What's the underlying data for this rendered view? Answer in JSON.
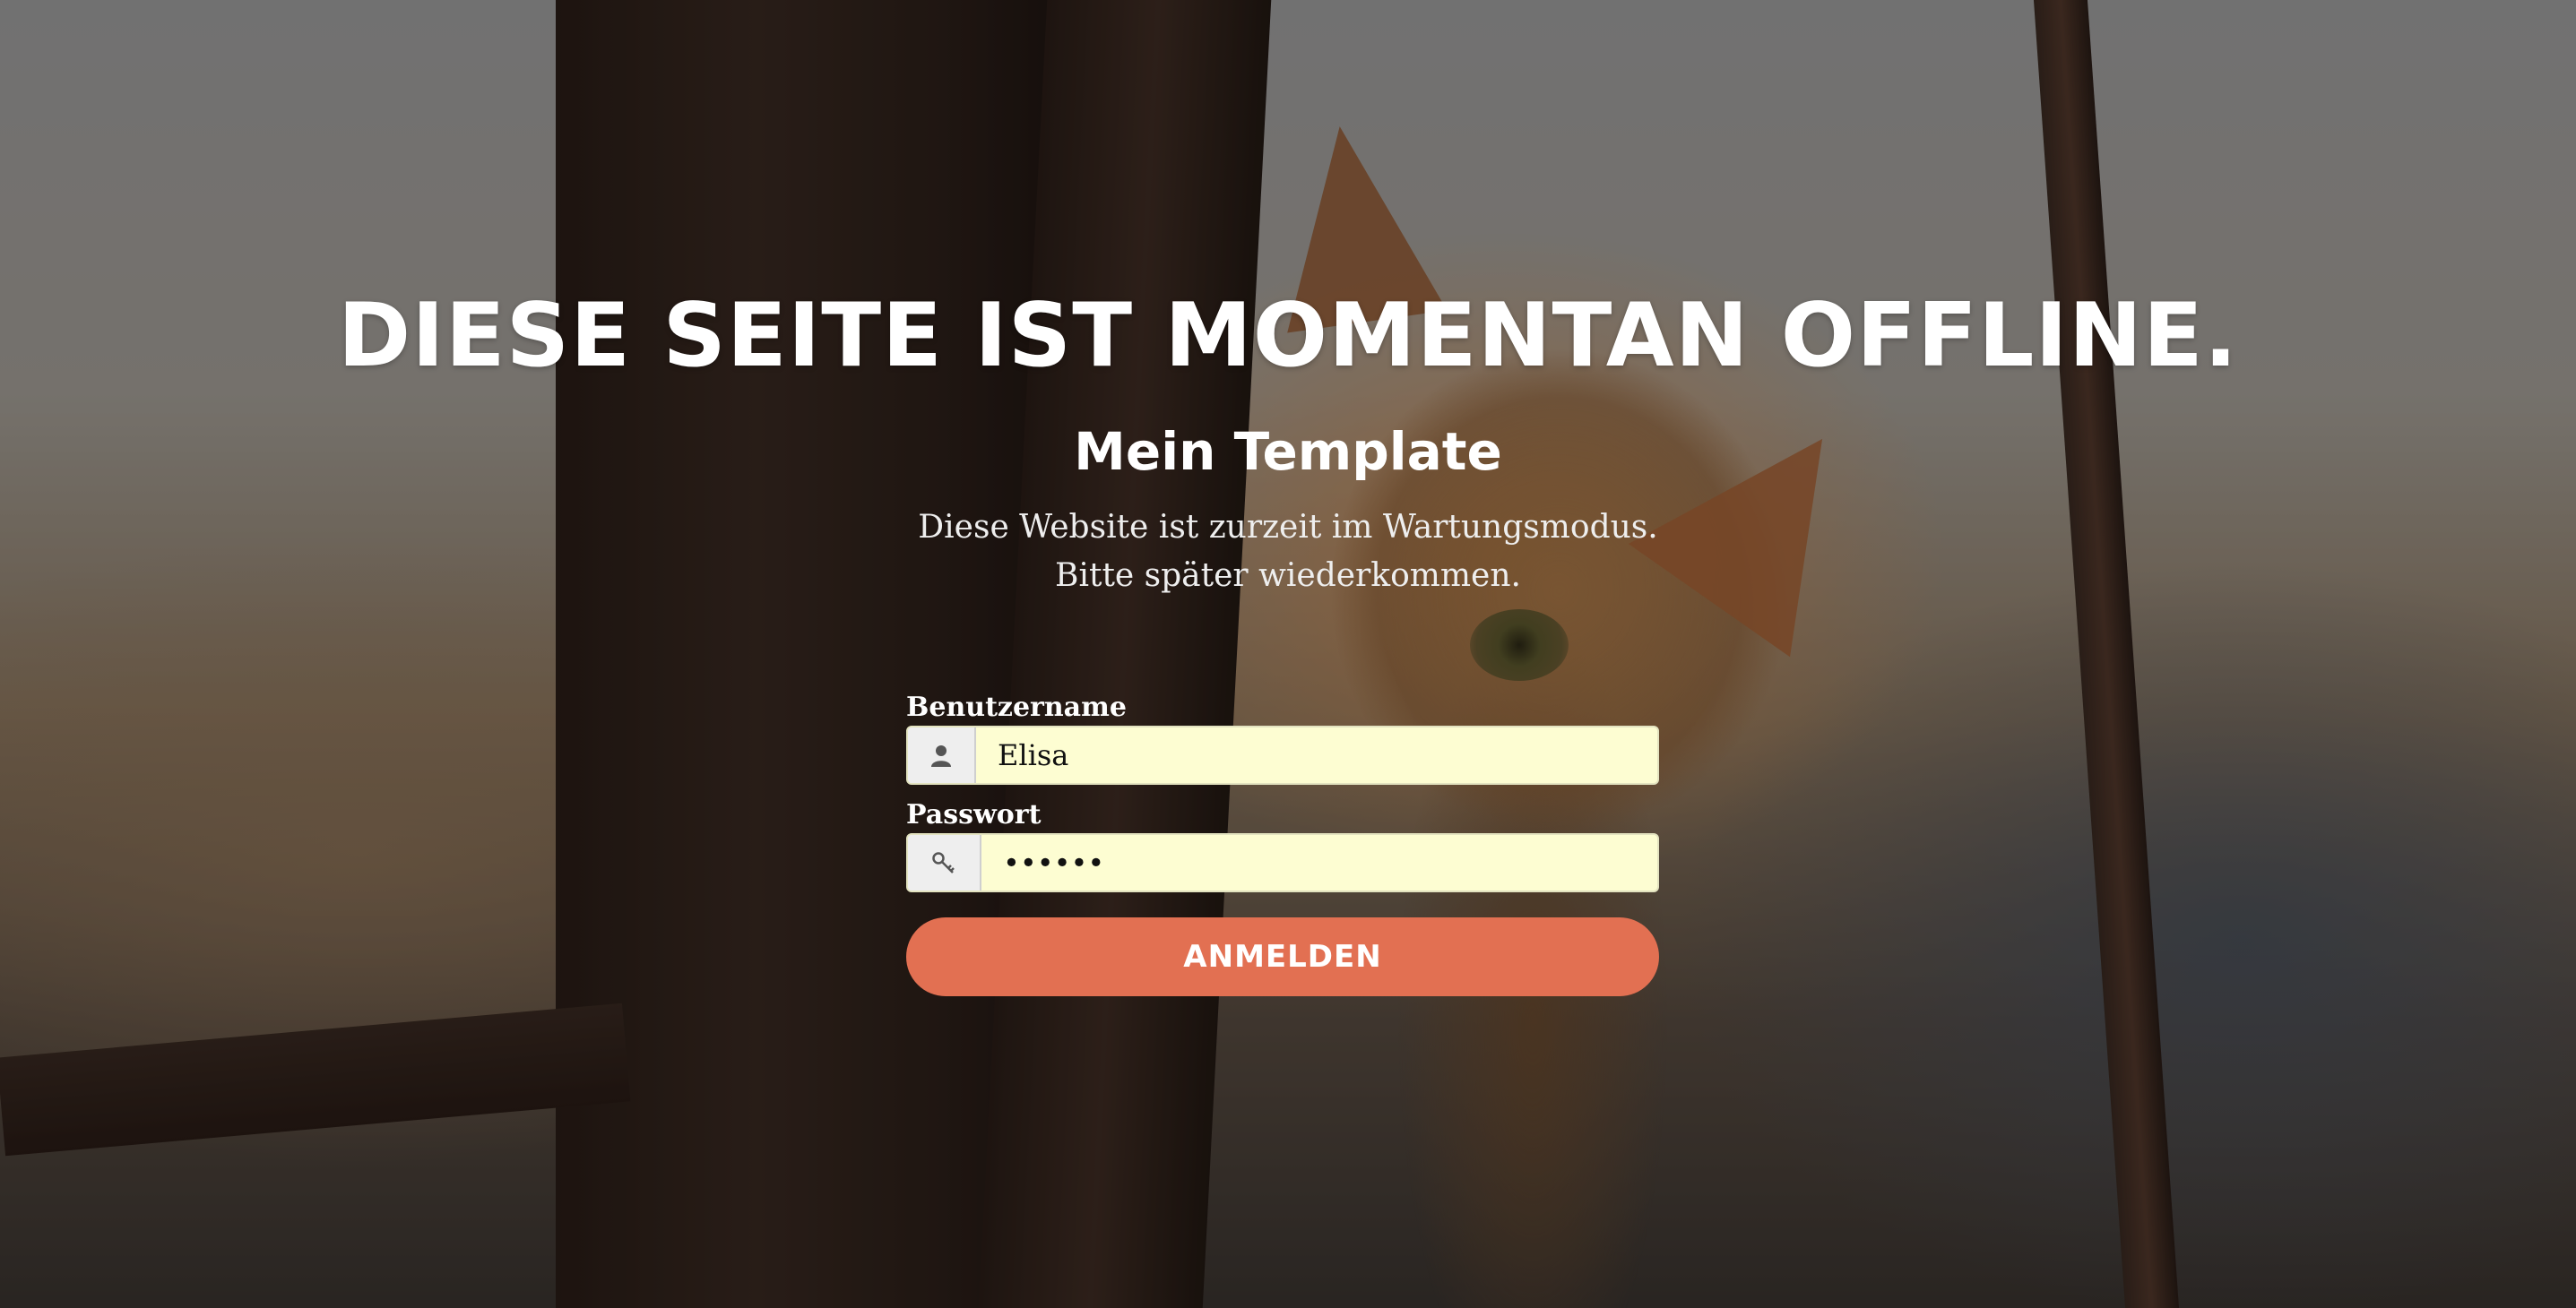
{
  "offline": {
    "headline": "DIESE SEITE IST MOMENTAN OFFLINE.",
    "site_name": "Mein Template",
    "message_line1": "Diese Website ist zurzeit im Wartungsmodus.",
    "message_line2": "Bitte später wiederkommen."
  },
  "login": {
    "username_label": "Benutzername",
    "username_value": "Elisa",
    "username_icon": "user-icon",
    "password_label": "Passwort",
    "password_value": "••••••",
    "password_icon": "key-icon",
    "submit_label": "ANMELDEN"
  },
  "colors": {
    "button": "#e27052",
    "input_autofill": "#fdfdd2",
    "text": "#ffffff"
  }
}
